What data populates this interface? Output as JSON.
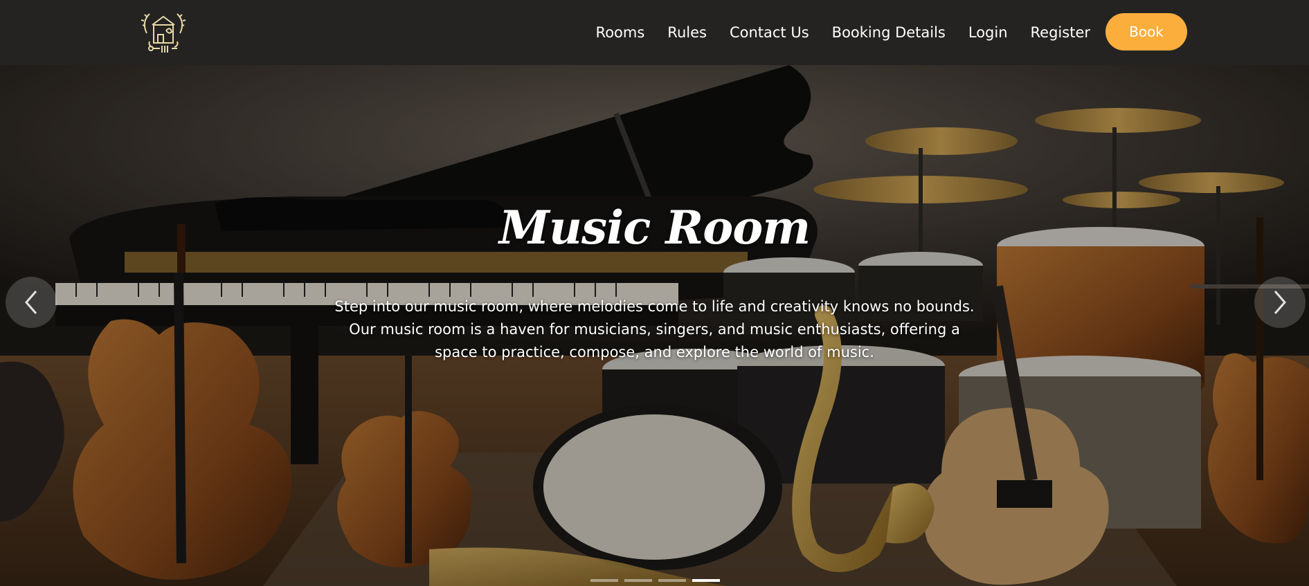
{
  "navbar": {
    "links": [
      {
        "label": "Rooms"
      },
      {
        "label": "Rules"
      },
      {
        "label": "Contact Us"
      },
      {
        "label": "Booking Details"
      },
      {
        "label": "Login"
      },
      {
        "label": "Register"
      }
    ],
    "book_label": "Book",
    "logo_icon": "music-house-logo-icon"
  },
  "hero": {
    "title": "Music Room",
    "description": "Step into our music room, where melodies come to life and creativity knows no bounds. Our music room is a haven for musicians, singers, and music enthusiasts, offering a space to practice, compose, and explore the world of music.",
    "prev_icon": "chevron-left-icon",
    "next_icon": "chevron-right-icon",
    "slide_count": 4,
    "active_slide": 4
  },
  "colors": {
    "navbar_bg": "#242322",
    "accent": "#fbae3c",
    "text": "#ffffff"
  }
}
